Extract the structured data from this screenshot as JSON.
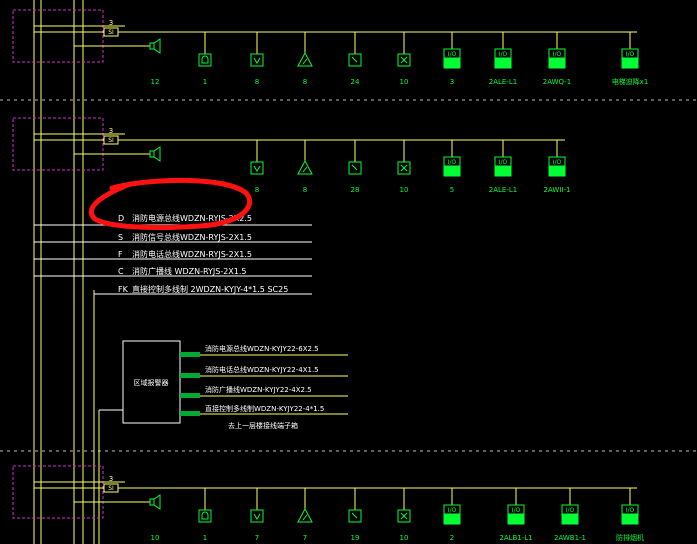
{
  "colors": {
    "background": "#000000",
    "wire": "#ffff66",
    "device": "#00ff33",
    "frame": "#cc33cc",
    "text": "#ffffff",
    "divider": "#bbbbbb",
    "annotation": "#ff1111"
  },
  "floors": [
    {
      "module_num": "3",
      "si": "SI",
      "devices": [
        {
          "icon": "speaker-icon",
          "count": "12"
        },
        {
          "icon": "phone-icon",
          "count": "1"
        },
        {
          "icon": "smoke-detector-icon",
          "count": "8"
        },
        {
          "icon": "heat-detector-icon",
          "count": "8"
        },
        {
          "icon": "manual-call-point-icon",
          "count": "24"
        },
        {
          "icon": "hydrant-button-icon",
          "count": "10"
        },
        {
          "icon": "io-module-icon",
          "count": "3"
        },
        {
          "icon": "io-module-icon",
          "count": "2ALE-L1"
        },
        {
          "icon": "io-module-icon",
          "count": "2AWQ-1"
        },
        {
          "icon": "io-module-icon",
          "count": "电梯迫降x1"
        }
      ]
    },
    {
      "module_num": "3",
      "si": "SI",
      "devices": [
        {
          "icon": "speaker-icon",
          "count": ""
        },
        {
          "icon": "smoke-detector-icon",
          "count": "8"
        },
        {
          "icon": "heat-detector-icon",
          "count": "8"
        },
        {
          "icon": "manual-call-point-icon",
          "count": "28"
        },
        {
          "icon": "hydrant-button-icon",
          "count": "10"
        },
        {
          "icon": "io-module-icon",
          "count": "5"
        },
        {
          "icon": "io-module-icon",
          "count": "2ALE-L1"
        },
        {
          "icon": "io-module-icon",
          "count": "2AWII-1"
        }
      ]
    },
    {
      "module_num": "3",
      "si": "SI",
      "devices": [
        {
          "icon": "speaker-icon",
          "count": "10"
        },
        {
          "icon": "phone-icon",
          "count": "1"
        },
        {
          "icon": "smoke-detector-icon",
          "count": "7"
        },
        {
          "icon": "heat-detector-icon",
          "count": "7"
        },
        {
          "icon": "manual-call-point-icon",
          "count": "19"
        },
        {
          "icon": "hydrant-button-icon",
          "count": "10"
        },
        {
          "icon": "io-module-icon",
          "count": "2"
        },
        {
          "icon": "io-module-icon",
          "count": "2ALB1-L1"
        },
        {
          "icon": "io-module-icon",
          "count": "2AWB1-1"
        },
        {
          "icon": "io-module-icon",
          "count": "防排烟机"
        }
      ]
    }
  ],
  "bus_lines": [
    {
      "code": "D",
      "label": "消防电源总线WDZN-RYJS-2X2.5"
    },
    {
      "code": "S",
      "label": "消防信号总线WDZN-RYJS-2X1.5"
    },
    {
      "code": "F",
      "label": "消防电话总线WDZN-RYJS-2X1.5"
    },
    {
      "code": "C",
      "label": "消防广播线  WDZN-RYJS-2X1.5"
    },
    {
      "code": "FK",
      "label": "直接控制多线制  2WDZN-KYJY-4*1.5  SC25"
    }
  ],
  "panel": {
    "title": "区域报警器",
    "lines": [
      "消防电源总线WDZN-KYJY22-6X2.5",
      "消防电话总线WDZN-KYJY22-4X1.5",
      "消防广播线WDZN-KYJY22-4X2.5",
      "直接控制多线制WDZN-KYJY22-4*1.5"
    ],
    "note": "去上一层楼接线端子箱"
  }
}
